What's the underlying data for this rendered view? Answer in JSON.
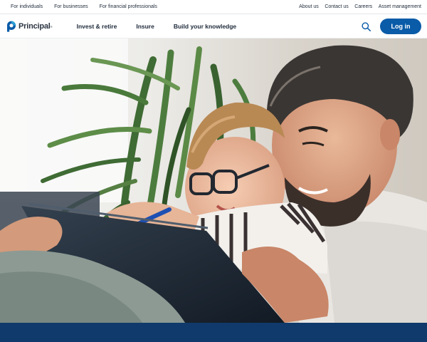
{
  "utility_bar": {
    "left_links": [
      {
        "label": "For individuals"
      },
      {
        "label": "For businesses"
      },
      {
        "label": "For financial professionals"
      }
    ],
    "right_links": [
      {
        "label": "About us"
      },
      {
        "label": "Contact us"
      },
      {
        "label": "Careers"
      },
      {
        "label": "Asset management"
      }
    ]
  },
  "header": {
    "logo": {
      "text": "Principal",
      "trademark": "®",
      "icon": "principal-logo-mark"
    },
    "nav_items": [
      {
        "label": "Invest & retire"
      },
      {
        "label": "Insure"
      },
      {
        "label": "Build your knowledge"
      }
    ],
    "search_icon": "search-icon",
    "login_label": "Log in"
  },
  "colors": {
    "brand_blue": "#0a5ba8",
    "navy_band": "#0f3a6b",
    "text": "#1e2a3a"
  },
  "hero": {
    "image": "father-and-son-with-tablet-photo"
  }
}
